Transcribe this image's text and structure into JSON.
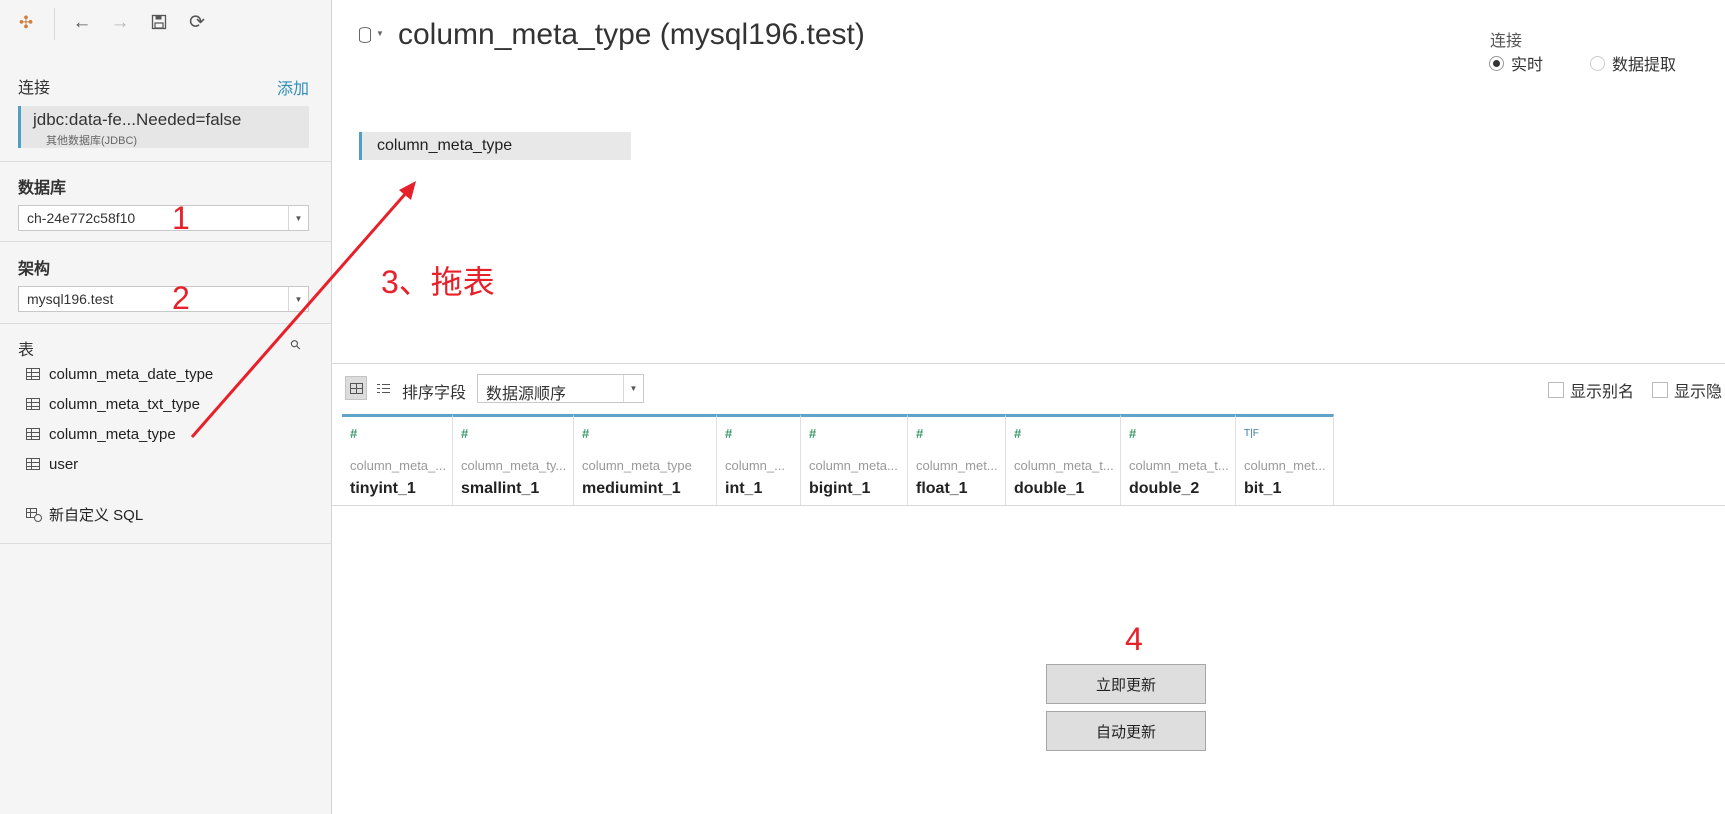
{
  "toolbar": {
    "icons": [
      "tableau-logo-icon",
      "back-arrow-icon",
      "forward-arrow-icon",
      "save-icon",
      "refresh-icon"
    ]
  },
  "sidebar": {
    "connections_label": "连接",
    "add_label": "添加",
    "connection": {
      "title": "jdbc:data-fe...Needed=false",
      "subtitle": "其他数据库(JDBC)"
    },
    "database_label": "数据库",
    "database_value": "ch-24e772c58f10",
    "schema_label": "架构",
    "schema_value": "mysql196.test",
    "tables_label": "表",
    "tables": [
      {
        "name": "column_meta_date_type"
      },
      {
        "name": "column_meta_txt_type"
      },
      {
        "name": "column_meta_type"
      },
      {
        "name": "user"
      }
    ],
    "custom_sql_label": "新自定义 SQL"
  },
  "header": {
    "title": "column_meta_type (mysql196.test)",
    "connection_mode_label": "连接",
    "live_label": "实时",
    "extract_label": "数据提取",
    "selected_mode": "live"
  },
  "canvas": {
    "table_name": "column_meta_type"
  },
  "annotations": {
    "step1": "1",
    "step2": "2",
    "step3": "3、拖表",
    "step4": "4",
    "color": "#e8202a"
  },
  "grid_toolbar": {
    "sort_label": "排序字段",
    "sort_value": "数据源顺序",
    "show_alias_label": "显示别名",
    "show_hidden_label": "显示隐"
  },
  "columns": [
    {
      "type_icon": "#",
      "source": "column_meta_...",
      "name": "tinyint_1"
    },
    {
      "type_icon": "#",
      "source": "column_meta_ty...",
      "name": "smallint_1"
    },
    {
      "type_icon": "#",
      "source": "column_meta_type",
      "name": "mediumint_1"
    },
    {
      "type_icon": "#",
      "source": "column_...",
      "name": "int_1"
    },
    {
      "type_icon": "#",
      "source": "column_meta...",
      "name": "bigint_1"
    },
    {
      "type_icon": "#",
      "source": "column_met...",
      "name": "float_1"
    },
    {
      "type_icon": "#",
      "source": "column_meta_t...",
      "name": "double_1"
    },
    {
      "type_icon": "#",
      "source": "column_meta_t...",
      "name": "double_2"
    },
    {
      "type_icon": "T|F",
      "source": "column_met...",
      "name": "bit_1"
    }
  ],
  "update_buttons": {
    "update_now": "立即更新",
    "auto_update": "自动更新"
  },
  "colors": {
    "accent": "#4e9fc4",
    "number_type": "#3a9a6a",
    "link": "#2d8fb8"
  }
}
